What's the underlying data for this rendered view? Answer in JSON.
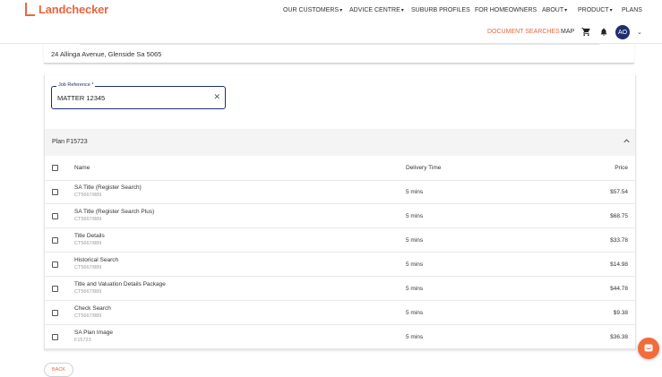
{
  "brand": {
    "name": "Landchecker",
    "color": "#e8663d"
  },
  "nav": {
    "items": [
      {
        "label": "OUR CUSTOMERS",
        "chevron": true
      },
      {
        "label": "ADVICE CENTRE",
        "chevron": true
      },
      {
        "label": "SUBURB PROFILES",
        "chevron": false
      },
      {
        "label": "FOR HOMEOWNERS",
        "chevron": false
      },
      {
        "label": "ABOUT",
        "chevron": true
      },
      {
        "label": "PRODUCT",
        "chevron": true
      },
      {
        "label": "PLANS",
        "chevron": false
      }
    ]
  },
  "subnav": {
    "document_searches": "DOCUMENT SEARCHES",
    "map": "MAP",
    "cart_icon": "shopping-cart-icon",
    "bell_icon": "bell-icon",
    "avatar_initials": "AO"
  },
  "address": {
    "text": "24 Allinga Avenue, Glenside Sa 5065"
  },
  "job_reference": {
    "label": "Job Reference *",
    "value": "MATTER 12345",
    "clear_icon": "close-icon"
  },
  "plan": {
    "title": "Plan F15723",
    "expanded": true
  },
  "table": {
    "headers": {
      "name": "Name",
      "delivery": "Delivery Time",
      "price": "Price"
    },
    "rows": [
      {
        "name": "SA Title (Register Search)",
        "sub": "CT5667/889",
        "time": "5 mins",
        "price": "$57.54"
      },
      {
        "name": "SA Title (Register Search Plus)",
        "sub": "CT5667/889",
        "time": "5 mins",
        "price": "$68.75"
      },
      {
        "name": "Title Details",
        "sub": "CT5667/889",
        "time": "5 mins",
        "price": "$33.78"
      },
      {
        "name": "Historical Search",
        "sub": "CT5667/889",
        "time": "5 mins",
        "price": "$14.98"
      },
      {
        "name": "Title and Valuation Details Package",
        "sub": "CT5667/889",
        "time": "5 mins",
        "price": "$44.78"
      },
      {
        "name": "Check Search",
        "sub": "CT5667/889",
        "time": "5 mins",
        "price": "$9.38"
      },
      {
        "name": "SA Plan Image",
        "sub": "F15723",
        "time": "5 mins",
        "price": "$36.38"
      }
    ]
  },
  "back_button": {
    "label": "BACK"
  },
  "chat": {
    "icon": "chat-icon",
    "color": "#f26b3a"
  }
}
